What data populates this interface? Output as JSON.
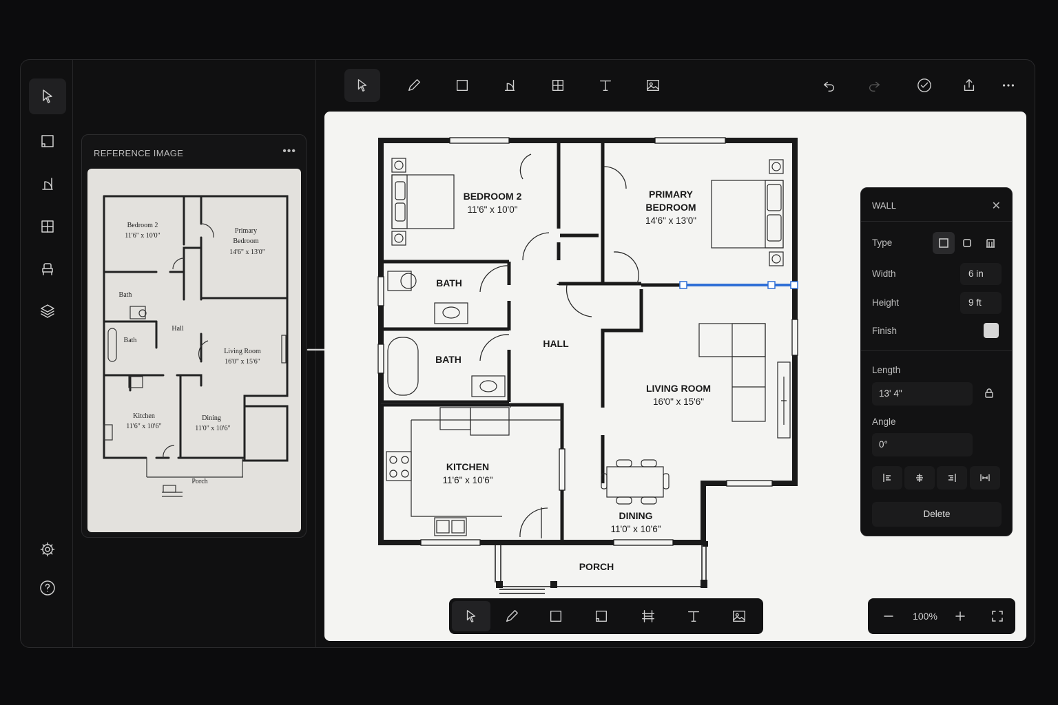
{
  "reference_panel": {
    "title": "REFERENCE IMAGE",
    "menu_icon": "more-horizontal-icon",
    "sketch_labels": {
      "bedroom2_name": "Bedroom 2",
      "bedroom2_dim": "11'6\" x 10'0\"",
      "primary_name1": "Primary",
      "primary_name2": "Bedroom",
      "primary_dim": "14'6\" x 13'0\"",
      "bath1": "Bath",
      "bath2": "Bath",
      "hall": "Hall",
      "living_name": "Living Room",
      "living_dim": "16'0\" x 15'6\"",
      "kitchen_name": "Kitchen",
      "kitchen_dim": "11'6\" x 10'6\"",
      "dining_name": "Dining",
      "dining_dim": "11'0\" x 10'6\"",
      "porch": "Porch"
    }
  },
  "plan_labels": {
    "bedroom2": {
      "name": "BEDROOM 2",
      "dim": "11'6\" x 10'0\""
    },
    "primary": {
      "name1": "PRIMARY",
      "name2": "BEDROOM",
      "dim": "14'6\" x 13'0\""
    },
    "bath1": {
      "name": "BATH"
    },
    "bath2": {
      "name": "BATH"
    },
    "hall": {
      "name": "HALL"
    },
    "living": {
      "name": "LIVING ROOM",
      "dim": "16'0\" x 15'6\""
    },
    "kitchen": {
      "name": "KITCHEN",
      "dim": "11'6\" x 10'6\""
    },
    "dining": {
      "name": "DINING",
      "dim": "11'0\" x 10'6\""
    },
    "porch": {
      "name": "PORCH"
    }
  },
  "wall_panel": {
    "title": "WALL",
    "type_label": "Type",
    "width_label": "Width",
    "width_value": "6 in",
    "height_label": "Height",
    "height_value": "9 ft",
    "finish_label": "Finish",
    "finish_color": "#d6d6d6",
    "length_label": "Length",
    "length_value": "13' 4\"",
    "angle_label": "Angle",
    "angle_value": "0°",
    "delete_label": "Delete"
  },
  "zoom": {
    "level": "100%"
  },
  "colors": {
    "selection": "#2f6fd6",
    "canvas": "#f4f4f2",
    "app_bg": "#101011"
  }
}
